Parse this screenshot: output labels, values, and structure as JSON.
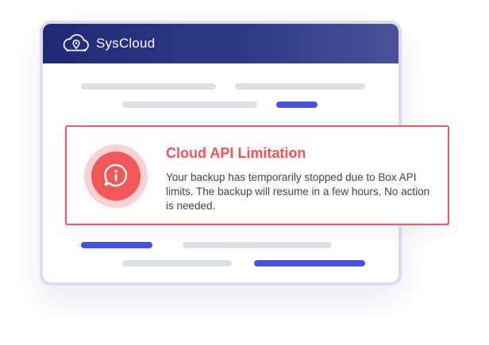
{
  "app": {
    "title": "SysCloud",
    "logo_icon": "cloud-pin-icon"
  },
  "alert": {
    "icon": "info-speech-bubble-icon",
    "title": "Cloud API Limitation",
    "message": "Your backup has temporarily stopped due to Box API limits. The backup will resume in a few hours. No action is needed."
  },
  "colors": {
    "titlebar": "#202a78",
    "alert_accent": "#f2575a",
    "placeholder_gray": "#dfe0e6",
    "placeholder_blue": "#4553df",
    "window_rim": "#dcdcf3"
  }
}
